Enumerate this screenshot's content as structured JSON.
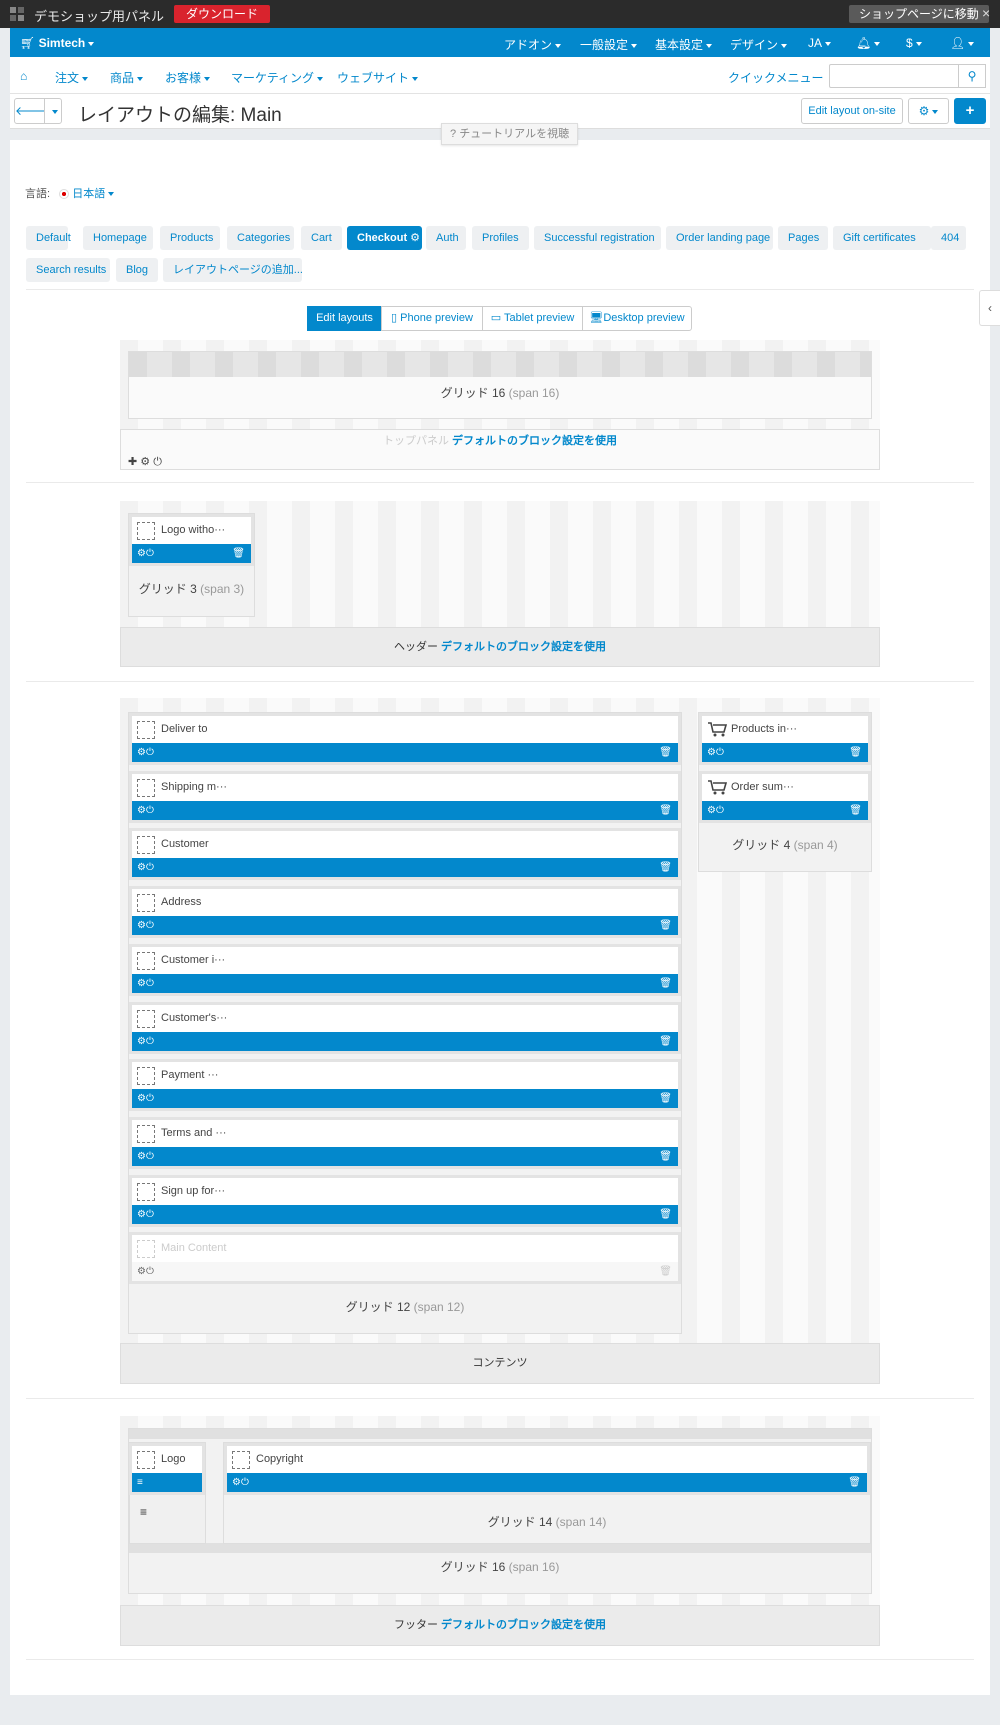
{
  "topbar": {
    "title": "デモショップ用パネル",
    "download": "ダウンロード",
    "go_shop": "ショップページに移動",
    "close": "×"
  },
  "bluebar": {
    "store": "Simtech",
    "addons": "アドオン",
    "general": "一般設定",
    "basic": "基本設定",
    "design": "デザイン",
    "lang": "JA",
    "currency": "$"
  },
  "nav": {
    "orders": "注文",
    "products": "商品",
    "customers": "お客様",
    "marketing": "マーケティング",
    "website": "ウェブサイト",
    "quick_menu": "クイックメニュー"
  },
  "titlebar": {
    "title": "レイアウトの編集: Main",
    "edit_on_site": "Edit layout on-site",
    "tutorial": "チュートリアルを視聴"
  },
  "language": {
    "label": "言語:",
    "value": "日本語"
  },
  "tabs": [
    "Default",
    "Homepage",
    "Products",
    "Categories",
    "Cart",
    "Checkout",
    "Auth",
    "Profiles",
    "Successful registration",
    "Order landing page",
    "Pages",
    "Gift certificates",
    "404",
    "Search results",
    "Blog",
    "レイアウトページの追加..."
  ],
  "active_tab": "Checkout",
  "view_modes": [
    "Edit layouts",
    "Phone preview",
    "Tablet preview",
    "Desktop preview"
  ],
  "top_panel": {
    "grid": "グリッド 16",
    "span": "(span 16)",
    "section": "トップパネル",
    "default_link": "デフォルトのブロック設定を使用"
  },
  "header": {
    "block": "Logo witho···",
    "grid": "グリッド 3",
    "span": "(span 3)",
    "section": "ヘッダー",
    "default_link": "デフォルトのブロック設定を使用"
  },
  "content": {
    "left_blocks": [
      "Deliver to",
      "Shipping m···",
      "Customer",
      "Address",
      "Customer i···",
      "Customer's···",
      "Payment ···",
      "Terms and ···",
      "Sign up for···",
      "Main Content"
    ],
    "left_grid": "グリッド 12",
    "left_span": "(span 12)",
    "right_blocks": [
      "Products in···",
      "Order sum···"
    ],
    "right_grid": "グリッド 4",
    "right_span": "(span 4)",
    "section": "コンテンツ"
  },
  "footer": {
    "logo": "Logo",
    "copyright": "Copyright",
    "grid14": "グリッド 14",
    "span14": "(span 14)",
    "grid16": "グリッド 16",
    "span16": "(span 16)",
    "section": "フッター",
    "default_link": "デフォルトのブロック設定を使用"
  },
  "colors": {
    "accent": "#0388cc",
    "download": "#d9232d"
  }
}
